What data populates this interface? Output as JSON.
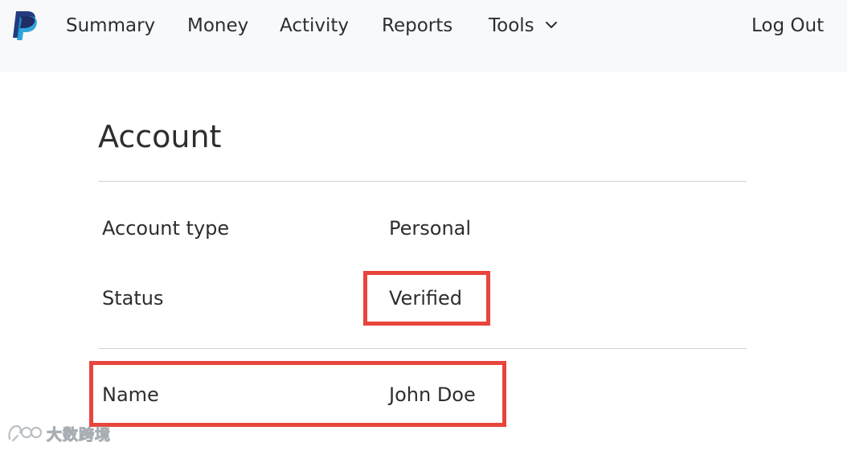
{
  "nav": {
    "logo_icon": "paypal-logo-icon",
    "items": [
      {
        "label": "Summary"
      },
      {
        "label": "Money"
      },
      {
        "label": "Activity"
      },
      {
        "label": "Reports"
      },
      {
        "label": "Tools"
      }
    ],
    "tools_icon": "chevron-down-icon",
    "logout_label": "Log Out"
  },
  "account": {
    "title": "Account",
    "rows": [
      {
        "label": "Account type",
        "value": "Personal"
      },
      {
        "label": "Status",
        "value": "Verified"
      },
      {
        "label": "Name",
        "value": "John Doe"
      }
    ]
  },
  "annotations": {
    "highlight_color": "#e8453c"
  },
  "watermark": {
    "text": "大数跨境"
  }
}
